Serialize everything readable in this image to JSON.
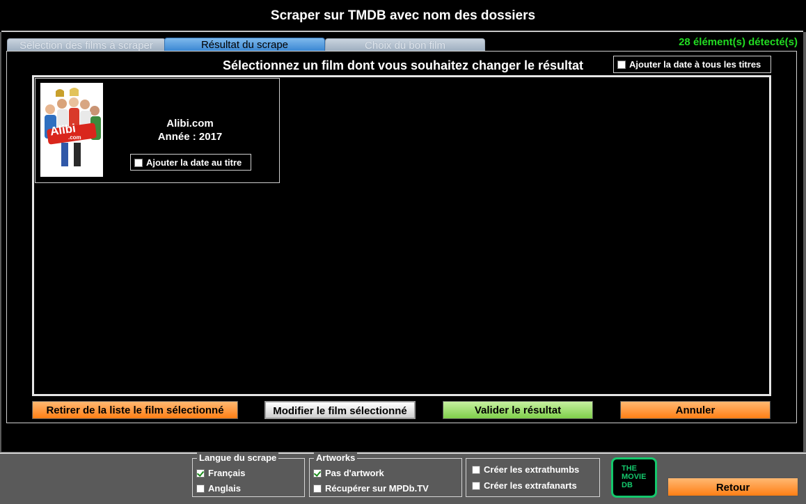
{
  "window": {
    "title": "Scraper sur TMDB avec nom des dossiers"
  },
  "tabs": [
    {
      "label": "Sélection des films à scraper",
      "active": false
    },
    {
      "label": "Résultat du scrape",
      "active": true
    },
    {
      "label": "Choix du bon film",
      "active": false
    }
  ],
  "status": {
    "count_text": "28 élément(s) détecté(s)"
  },
  "main": {
    "prompt": "Sélectionnez un film dont vous souhaitez changer le résultat",
    "add_date_all_label": "Ajouter la date à tous les titres",
    "add_date_all_checked": false
  },
  "film": {
    "poster_text": "Alibi",
    "poster_subtext": ".com",
    "title": "Alibi.com",
    "year_text": "Année : 2017",
    "add_date_label": "Ajouter la date au titre",
    "add_date_checked": false
  },
  "buttons": {
    "remove": "Retirer de la liste le film sélectionné",
    "modify": "Modifier le film sélectionné",
    "validate": "Valider le résultat",
    "cancel": "Annuler",
    "back": "Retour"
  },
  "language_group": {
    "legend": "Langue du scrape",
    "options": [
      {
        "label": "Français",
        "checked": true
      },
      {
        "label": "Anglais",
        "checked": false
      }
    ]
  },
  "artworks_group": {
    "legend": "Artworks",
    "options": [
      {
        "label": "Pas d'artwork",
        "checked": true
      },
      {
        "label": "Récupérer sur MPDb.TV",
        "checked": false
      }
    ]
  },
  "extras": [
    {
      "label": "Créer les extrathumbs",
      "checked": false
    },
    {
      "label": "Créer les extrafanarts",
      "checked": false
    }
  ],
  "logo": {
    "line1": "THE",
    "line2": "MOVIE",
    "line3": "DB"
  },
  "colors": {
    "accent_green": "#22dd22",
    "orange": "#ff8a1e",
    "tmdb_green": "#14c86c",
    "tab_blue": "#2f7fcf"
  }
}
